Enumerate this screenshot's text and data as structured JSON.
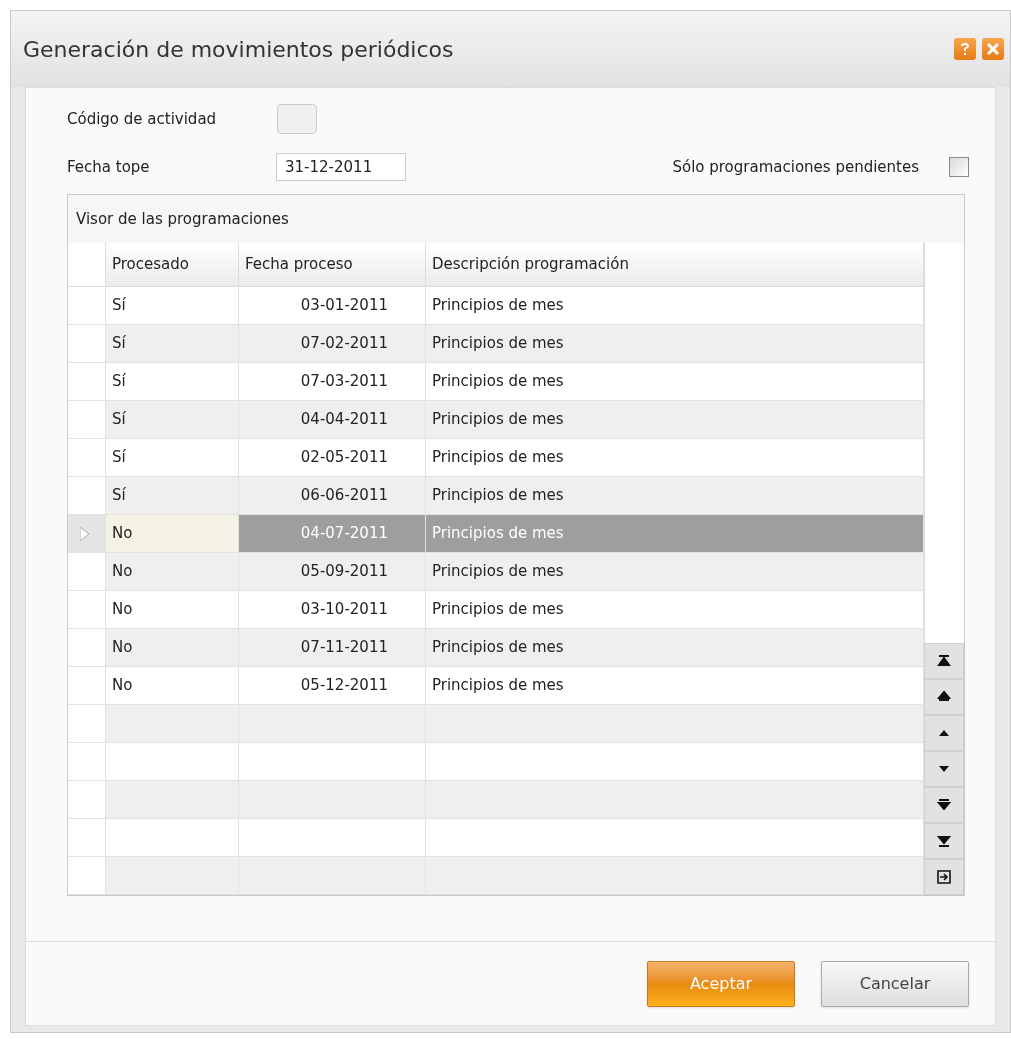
{
  "window": {
    "title": "Generación de movimientos periódicos"
  },
  "fields": {
    "activity_code": {
      "label": "Código de actividad"
    },
    "deadline": {
      "label": "Fecha tope",
      "value": "31-12-2011"
    },
    "only_pending": {
      "label": "Sólo programaciones pendientes",
      "checked": false
    }
  },
  "grid": {
    "title": "Visor de las programaciones",
    "columns": [
      "Procesado",
      "Fecha proceso",
      "Descripción programación"
    ],
    "rows": [
      {
        "processed": "Sí",
        "date": "03-01-2011",
        "description": "Principios de mes",
        "selected": false
      },
      {
        "processed": "Sí",
        "date": "07-02-2011",
        "description": "Principios de mes",
        "selected": false
      },
      {
        "processed": "Sí",
        "date": "07-03-2011",
        "description": "Principios de mes",
        "selected": false
      },
      {
        "processed": "Sí",
        "date": "04-04-2011",
        "description": "Principios de mes",
        "selected": false
      },
      {
        "processed": "Sí",
        "date": "02-05-2011",
        "description": "Principios de mes",
        "selected": false
      },
      {
        "processed": "Sí",
        "date": "06-06-2011",
        "description": "Principios de mes",
        "selected": false
      },
      {
        "processed": "No",
        "date": "04-07-2011",
        "description": "Principios de mes",
        "selected": true
      },
      {
        "processed": "No",
        "date": "05-09-2011",
        "description": "Principios de mes",
        "selected": false
      },
      {
        "processed": "No",
        "date": "03-10-2011",
        "description": "Principios de mes",
        "selected": false
      },
      {
        "processed": "No",
        "date": "07-11-2011",
        "description": "Principios de mes",
        "selected": false
      },
      {
        "processed": "No",
        "date": "05-12-2011",
        "description": "Principios de mes",
        "selected": false
      }
    ]
  },
  "buttons": [
    {
      "label": "Aceptar",
      "kind": "primary"
    },
    {
      "label": "Cancelar",
      "kind": "secondary"
    }
  ]
}
